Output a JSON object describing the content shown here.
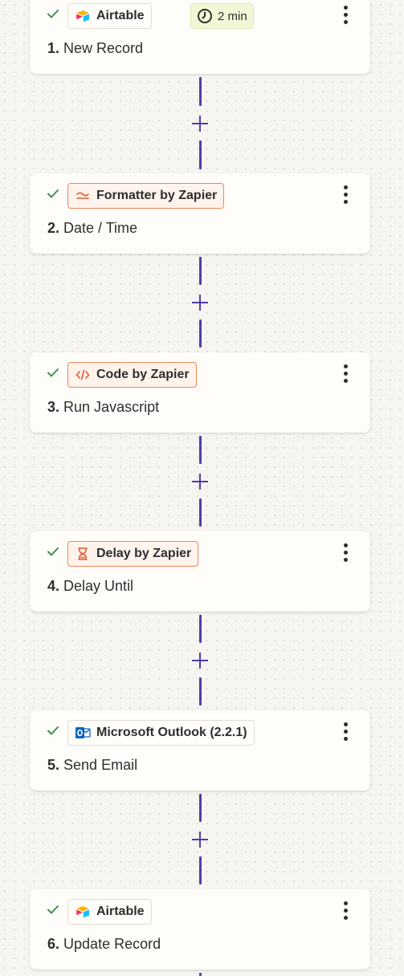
{
  "steps": [
    {
      "number": "1.",
      "action": "New Record",
      "app": "Airtable",
      "icon": "airtable-icon",
      "badge": "2 min",
      "status": "done"
    },
    {
      "number": "2.",
      "action": "Date / Time",
      "app": "Formatter by Zapier",
      "icon": "formatter-icon",
      "status": "done"
    },
    {
      "number": "3.",
      "action": "Run Javascript",
      "app": "Code by Zapier",
      "icon": "code-icon",
      "status": "done"
    },
    {
      "number": "4.",
      "action": "Delay Until",
      "app": "Delay by Zapier",
      "icon": "hourglass-icon",
      "status": "done"
    },
    {
      "number": "5.",
      "action": "Send Email",
      "app": "Microsoft Outlook (2.2.1)",
      "icon": "outlook-icon",
      "status": "done"
    },
    {
      "number": "6.",
      "action": "Update Record",
      "app": "Airtable",
      "icon": "airtable-icon",
      "status": "done"
    }
  ],
  "colors": {
    "connector": "#4e3fa8",
    "check": "#3d8f4f",
    "zapier_orange": "#f0855a",
    "badge_bg": "#f1f8d6",
    "canvas_bg": "#f6f5f1"
  }
}
